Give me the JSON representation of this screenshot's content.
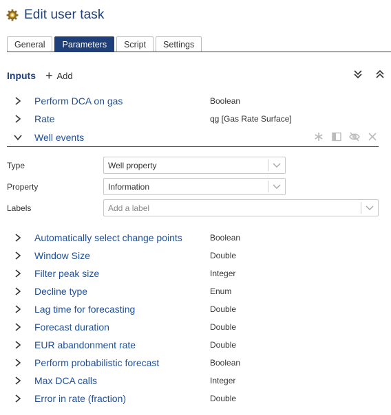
{
  "header": {
    "title": "Edit user task",
    "icon": "gear-icon"
  },
  "tabs": [
    {
      "label": "General",
      "active": false
    },
    {
      "label": "Parameters",
      "active": true
    },
    {
      "label": "Script",
      "active": false
    },
    {
      "label": "Settings",
      "active": false
    }
  ],
  "inputs": {
    "label": "Inputs",
    "add_label": "Add"
  },
  "top_params": [
    {
      "name": "Perform DCA on gas",
      "type": "Boolean"
    },
    {
      "name": "Rate",
      "type": "qg [Gas Rate Surface]"
    }
  ],
  "expanded": {
    "name": "Well events",
    "fields": {
      "type_label": "Type",
      "type_value": "Well property",
      "property_label": "Property",
      "property_value": "Information",
      "labels_label": "Labels",
      "labels_placeholder": "Add a label"
    }
  },
  "params": [
    {
      "name": "Automatically select change points",
      "type": "Boolean"
    },
    {
      "name": "Window Size",
      "type": "Double"
    },
    {
      "name": "Filter peak size",
      "type": "Integer"
    },
    {
      "name": "Decline type",
      "type": "Enum"
    },
    {
      "name": "Lag time for forecasting",
      "type": "Double"
    },
    {
      "name": "Forecast duration",
      "type": "Double"
    },
    {
      "name": "EUR abandonment rate",
      "type": "Double"
    },
    {
      "name": "Perform probabilistic forecast",
      "type": "Boolean"
    },
    {
      "name": "Max DCA calls",
      "type": "Integer"
    },
    {
      "name": "Error in rate (fraction)",
      "type": "Double"
    }
  ],
  "colors": {
    "accent": "#1f3f7a",
    "link": "#1f4f9a"
  }
}
